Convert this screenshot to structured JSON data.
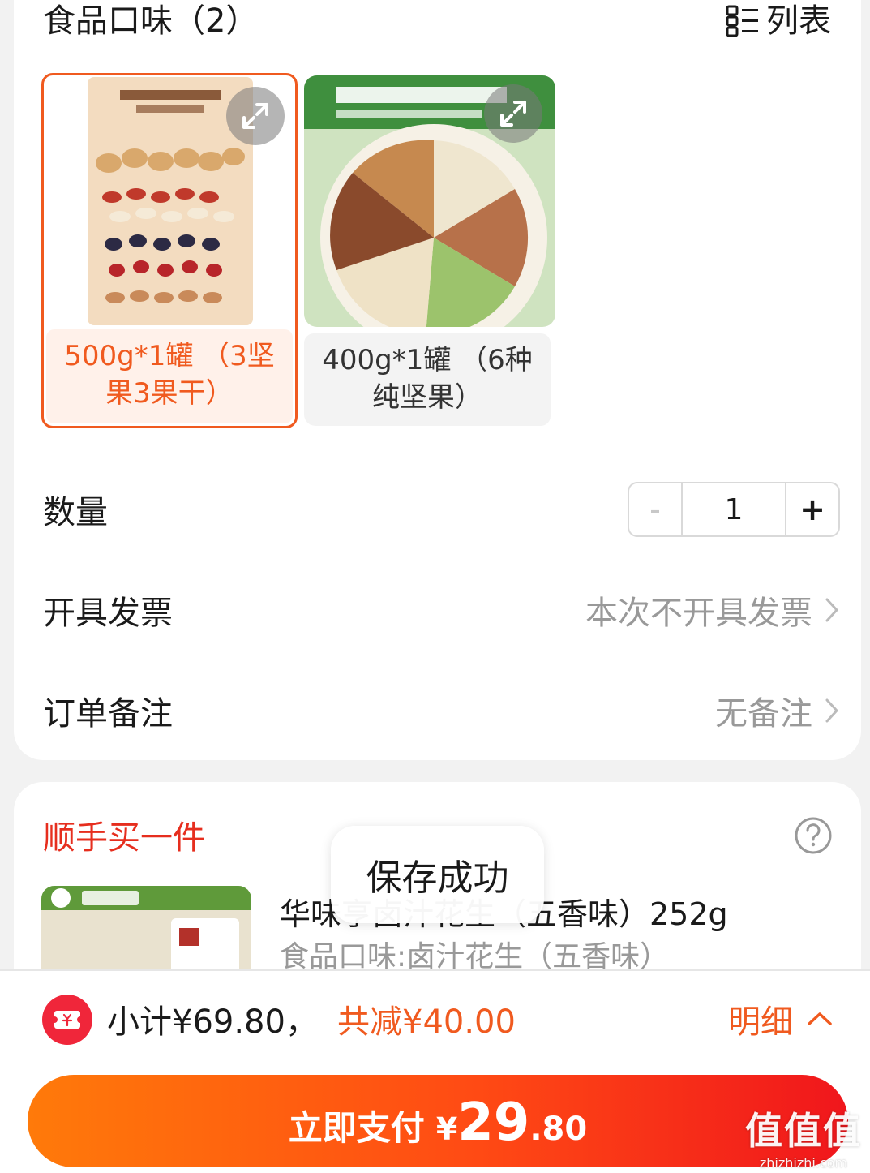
{
  "options": {
    "title": "食品口味（2）",
    "list_toggle_label": "列表",
    "variants": [
      {
        "label": "500g*1罐 （3坚果3果干）",
        "selected": true
      },
      {
        "label": "400g*1罐 （6种纯坚果）",
        "selected": false
      }
    ]
  },
  "quantity": {
    "label": "数量",
    "minus": "-",
    "value": "1",
    "plus": "+"
  },
  "invoice": {
    "label": "开具发票",
    "value": "本次不开具发票"
  },
  "note": {
    "label": "订单备注",
    "value": "无备注"
  },
  "addon": {
    "title": "顺手买一件",
    "product_name": "华味亨卤汁花生（五香味）252g",
    "product_spec": "食品口味:卤汁花生（五香味）"
  },
  "toast": {
    "text": "保存成功"
  },
  "summary": {
    "subtotal": "小计¥69.80，",
    "discount": "共减¥40.00",
    "details_label": "明细"
  },
  "pay": {
    "label": "立即支付",
    "currency": "¥",
    "amount_int": "29",
    "amount_dec": ".80"
  },
  "watermark": {
    "big": "值值值",
    "small": "zhizhizhi.com"
  },
  "colors": {
    "accent": "#f05a1f",
    "addon_title": "#e62e1e",
    "pay_start": "#ff7a0a",
    "pay_end": "#f0161c"
  }
}
